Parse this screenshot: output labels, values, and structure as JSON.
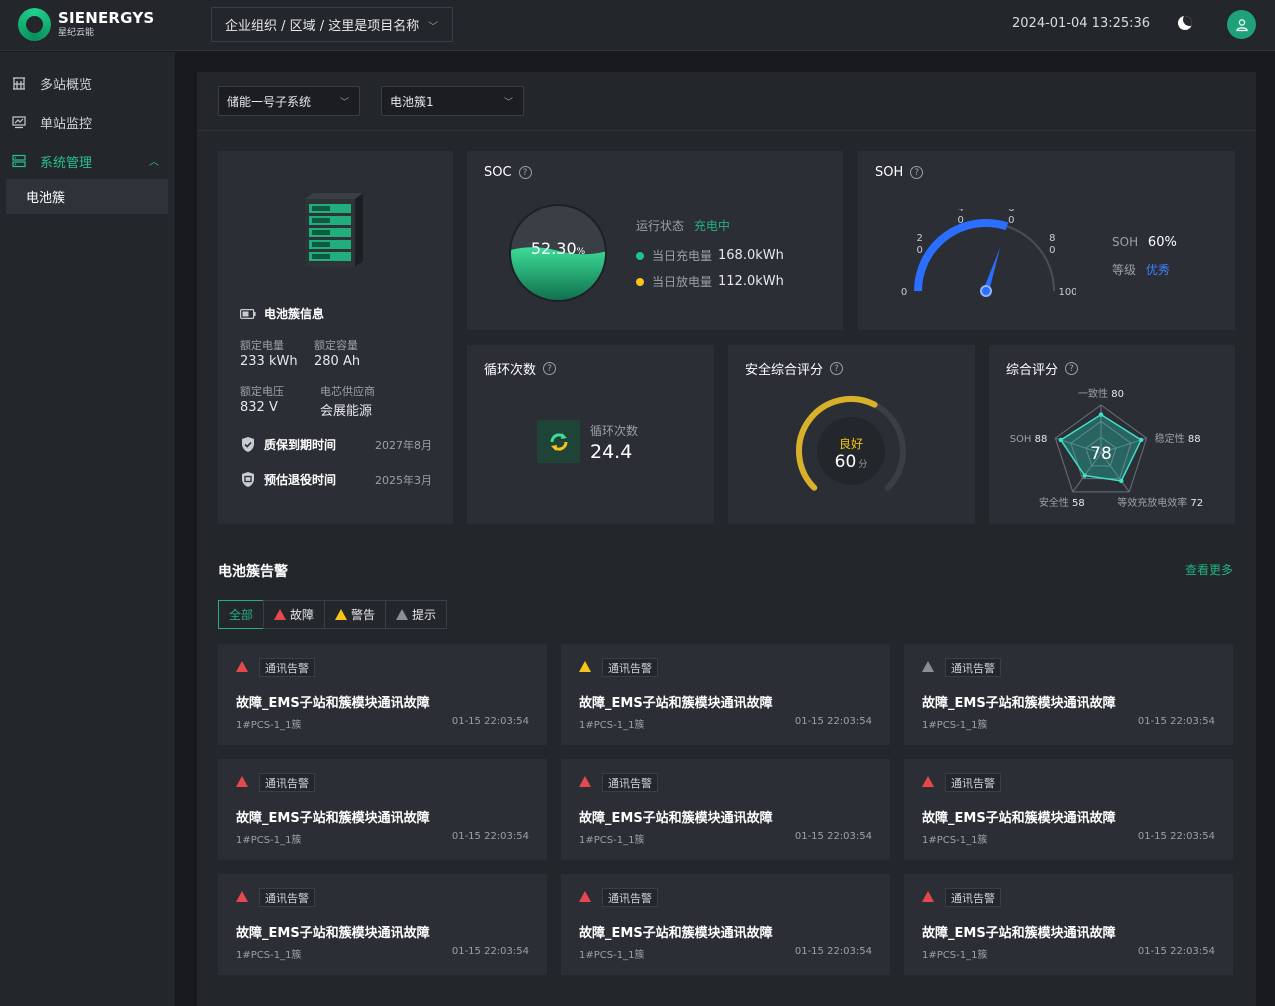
{
  "brand": {
    "name": "SIENERGYS",
    "sub": "星纪云能"
  },
  "header": {
    "breadcrumb": "企业组织 / 区域 / 这里是项目名称",
    "datetime": "2024-01-04  13:25:36"
  },
  "sidebar": {
    "items": [
      {
        "label": "多站概览",
        "icon": "building-icon"
      },
      {
        "label": "单站监控",
        "icon": "monitor-icon"
      },
      {
        "label": "系统管理",
        "icon": "system-icon"
      }
    ],
    "sub_item": "电池簇"
  },
  "filters": {
    "subsystem": "储能一号子系统",
    "cluster": "电池簇1"
  },
  "battery_info": {
    "title": "电池簇信息",
    "rated_energy_label": "额定电量",
    "rated_energy": "233 kWh",
    "rated_capacity_label": "额定容量",
    "rated_capacity": "280 Ah",
    "rated_voltage_label": "额定电压",
    "rated_voltage": "832 V",
    "supplier_label": "电芯供应商",
    "supplier": "会展能源",
    "warranty_label": "质保到期时间",
    "warranty": "2027年8月",
    "retire_label": "预估退役时间",
    "retire": "2025年3月"
  },
  "soc": {
    "title": "SOC",
    "value": "52.30",
    "unit": "%",
    "fill_fraction": 0.523,
    "status_label": "运行状态",
    "status": "充电中",
    "charge_label": "当日充电量",
    "charge": "168.0kWh",
    "discharge_label": "当日放电量",
    "discharge": "112.0kWh"
  },
  "soh": {
    "title": "SOH",
    "value_label": "SOH",
    "value": "60%",
    "grade_label": "等级",
    "grade": "优秀",
    "gauge_value": 60,
    "ticks": [
      "0",
      "2\n0",
      "4\n0",
      "6\n0",
      "8\n0",
      "100"
    ]
  },
  "cycles": {
    "title": "循环次数",
    "label": "循环次数",
    "value": "24.4"
  },
  "safety": {
    "title": "安全综合评分",
    "grade": "良好",
    "score": "60",
    "unit": "分",
    "score_value": 60
  },
  "overall": {
    "title": "综合评分",
    "score": "78",
    "axes": [
      {
        "name": "一致性",
        "value": 80
      },
      {
        "name": "稳定性",
        "value": 88
      },
      {
        "name": "等效充放电效率",
        "value": 72
      },
      {
        "name": "安全性",
        "value": 58
      },
      {
        "name": "SOH",
        "value": 88
      }
    ]
  },
  "alerts": {
    "title": "电池簇告警",
    "more": "查看更多",
    "tabs": [
      "全部",
      "故障",
      "警告",
      "提示"
    ],
    "items": [
      {
        "level": "fault",
        "tag": "通讯告警",
        "title": "故障_EMS子站和簇模块通讯故障",
        "device": "1#PCS-1_1簇",
        "time": "01-15 22:03:54"
      },
      {
        "level": "warning",
        "tag": "通讯告警",
        "title": "故障_EMS子站和簇模块通讯故障",
        "device": "1#PCS-1_1簇",
        "time": "01-15 22:03:54"
      },
      {
        "level": "info",
        "tag": "通讯告警",
        "title": "故障_EMS子站和簇模块通讯故障",
        "device": "1#PCS-1_1簇",
        "time": "01-15 22:03:54"
      },
      {
        "level": "fault",
        "tag": "通讯告警",
        "title": "故障_EMS子站和簇模块通讯故障",
        "device": "1#PCS-1_1簇",
        "time": "01-15 22:03:54"
      },
      {
        "level": "fault",
        "tag": "通讯告警",
        "title": "故障_EMS子站和簇模块通讯故障",
        "device": "1#PCS-1_1簇",
        "time": "01-15 22:03:54"
      },
      {
        "level": "fault",
        "tag": "通讯告警",
        "title": "故障_EMS子站和簇模块通讯故障",
        "device": "1#PCS-1_1簇",
        "time": "01-15 22:03:54"
      },
      {
        "level": "fault",
        "tag": "通讯告警",
        "title": "故障_EMS子站和簇模块通讯故障",
        "device": "1#PCS-1_1簇",
        "time": "01-15 22:03:54"
      },
      {
        "level": "fault",
        "tag": "通讯告警",
        "title": "故障_EMS子站和簇模块通讯故障",
        "device": "1#PCS-1_1簇",
        "time": "01-15 22:03:54"
      },
      {
        "level": "fault",
        "tag": "通讯告警",
        "title": "故障_EMS子站和簇模块通讯故障",
        "device": "1#PCS-1_1簇",
        "time": "01-15 22:03:54"
      }
    ]
  },
  "colors": {
    "accent": "#22b07e",
    "fault": "#e5484d",
    "warning": "#f5c518",
    "info": "#8a8f96",
    "soh_blue": "#2a6fff"
  }
}
